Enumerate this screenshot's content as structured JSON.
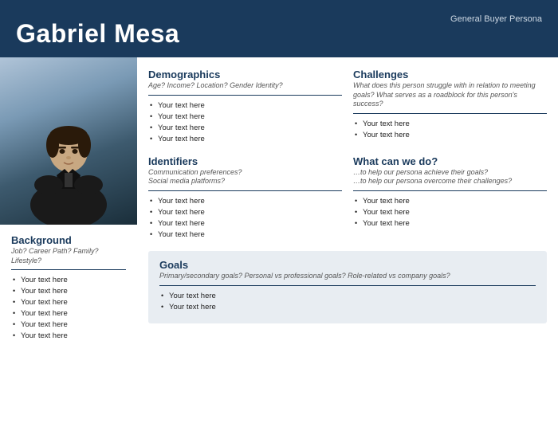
{
  "header": {
    "title": "Gabriel Mesa",
    "subtitle": "General Buyer Persona"
  },
  "left": {
    "background": {
      "title": "Background",
      "subtitle": "Job? Career Path? Family?\nLifestyle?",
      "items": [
        "Your text here",
        "Your text here",
        "Your text here",
        "Your text here",
        "Your text here",
        "Your text here"
      ]
    }
  },
  "sections": {
    "demographics": {
      "title": "Demographics",
      "subtitle": "Age? Income? Location? Gender Identity?",
      "items": [
        "Your text here",
        "Your text here",
        "Your text here",
        "Your text here"
      ]
    },
    "identifiers": {
      "title": "Identifiers",
      "subtitle": "Communication preferences?\nSocial media platforms?",
      "items": [
        "Your text here",
        "Your text here",
        "Your text here",
        "Your text here"
      ]
    },
    "challenges": {
      "title": "Challenges",
      "subtitle": "What does this person struggle with in relation to meeting goals? What serves as a roadblock for this person's success?",
      "items": [
        "Your text here",
        "Your text here"
      ]
    },
    "what_can_we_do": {
      "title": "What can we do?",
      "subtitle": "…to help our persona achieve their goals?\n…to help our persona overcome their challenges?",
      "items": [
        "Your text here",
        "Your text here",
        "Your text here"
      ]
    },
    "goals": {
      "title": "Goals",
      "subtitle": "Primary/secondary goals?  Personal vs professional goals? Role-related vs company goals?",
      "items": [
        "Your text here",
        "Your text here"
      ]
    }
  }
}
